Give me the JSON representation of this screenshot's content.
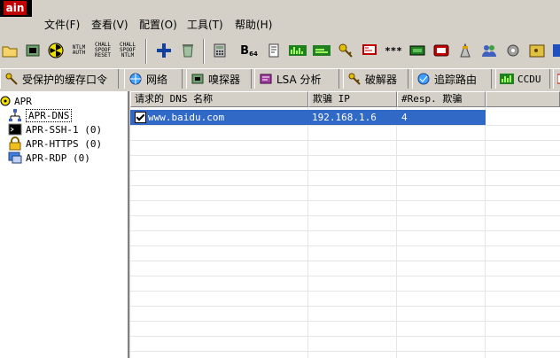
{
  "app": {
    "logo_text": "ain"
  },
  "menu": [
    {
      "label": "文件(F)"
    },
    {
      "label": "查看(V)"
    },
    {
      "label": "配置(O)"
    },
    {
      "label": "工具(T)"
    },
    {
      "label": "帮助(H)"
    }
  ],
  "toolbar": {
    "labels": {
      "ntlm_auth": "NTLM AUTH",
      "chall_spoof_reset": "CHALL SPOOF RESET",
      "chall_spoof_ntlm": "CHALL SPOOF NTLM",
      "base64": "B",
      "base64_sub": "64",
      "stars": "***"
    }
  },
  "tabs": [
    {
      "label": "受保护的缓存口令",
      "icon": "key-icon"
    },
    {
      "label": "网络",
      "icon": "network-icon"
    },
    {
      "label": "嗅探器",
      "icon": "sniffer-icon"
    },
    {
      "label": "LSA 分析",
      "icon": "lsa-icon"
    },
    {
      "label": "破解器",
      "icon": "cracker-icon"
    },
    {
      "label": "追踪路由",
      "icon": "traceroute-icon"
    },
    {
      "label": "CCDU",
      "icon": "ccdu-icon"
    }
  ],
  "tree": {
    "root": "APR",
    "items": [
      {
        "label": "APR-DNS",
        "selected": true
      },
      {
        "label": "APR-SSH-1 (0)"
      },
      {
        "label": "APR-HTTPS (0)"
      },
      {
        "label": "APR-RDP (0)"
      }
    ]
  },
  "list": {
    "columns": [
      "请求的 DNS 名称",
      "欺骗 IP",
      "#Resp. 欺骗"
    ],
    "rows": [
      {
        "checked": true,
        "name": "www.baidu.com",
        "ip": "192.168.1.6",
        "resp": "4"
      }
    ]
  },
  "colors": {
    "selection": "#3169c6",
    "face": "#d4d0c8"
  }
}
